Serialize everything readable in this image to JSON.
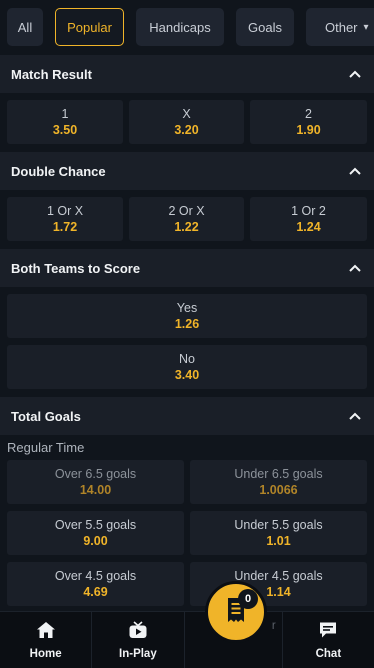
{
  "tabs": [
    {
      "label": "All",
      "active": false
    },
    {
      "label": "Popular",
      "active": true
    },
    {
      "label": "Handicaps",
      "active": false
    },
    {
      "label": "Goals",
      "active": false
    },
    {
      "label": "Other",
      "active": false
    }
  ],
  "markets": {
    "match_result": {
      "title": "Match Result",
      "odds": [
        {
          "label": "1",
          "value": "3.50"
        },
        {
          "label": "X",
          "value": "3.20"
        },
        {
          "label": "2",
          "value": "1.90"
        }
      ]
    },
    "double_chance": {
      "title": "Double Chance",
      "odds": [
        {
          "label": "1 Or X",
          "value": "1.72"
        },
        {
          "label": "2 Or X",
          "value": "1.22"
        },
        {
          "label": "1 Or 2",
          "value": "1.24"
        }
      ]
    },
    "btts": {
      "title": "Both Teams to Score",
      "odds": [
        {
          "label": "Yes",
          "value": "1.26"
        },
        {
          "label": "No",
          "value": "3.40"
        }
      ]
    },
    "total_goals": {
      "title": "Total Goals",
      "subheading": "Regular Time",
      "rows": [
        {
          "over_label": "Over 6.5 goals",
          "over_value": "14.00",
          "under_label": "Under 6.5 goals",
          "under_value": "1.0066"
        },
        {
          "over_label": "Over 5.5 goals",
          "over_value": "9.00",
          "under_label": "Under 5.5 goals",
          "under_value": "1.01"
        },
        {
          "over_label": "Over 4.5 goals",
          "over_value": "4.69",
          "under_label": "Under 4.5 goals",
          "under_value": "1.14"
        }
      ]
    }
  },
  "bottom_nav": {
    "home": "Home",
    "inplay": "In-Play",
    "betslip_partial": "r",
    "chat": "Chat"
  },
  "betslip": {
    "count": "0"
  },
  "colors": {
    "accent": "#f0b429",
    "background": "#10151c",
    "card": "#1a1f28"
  }
}
